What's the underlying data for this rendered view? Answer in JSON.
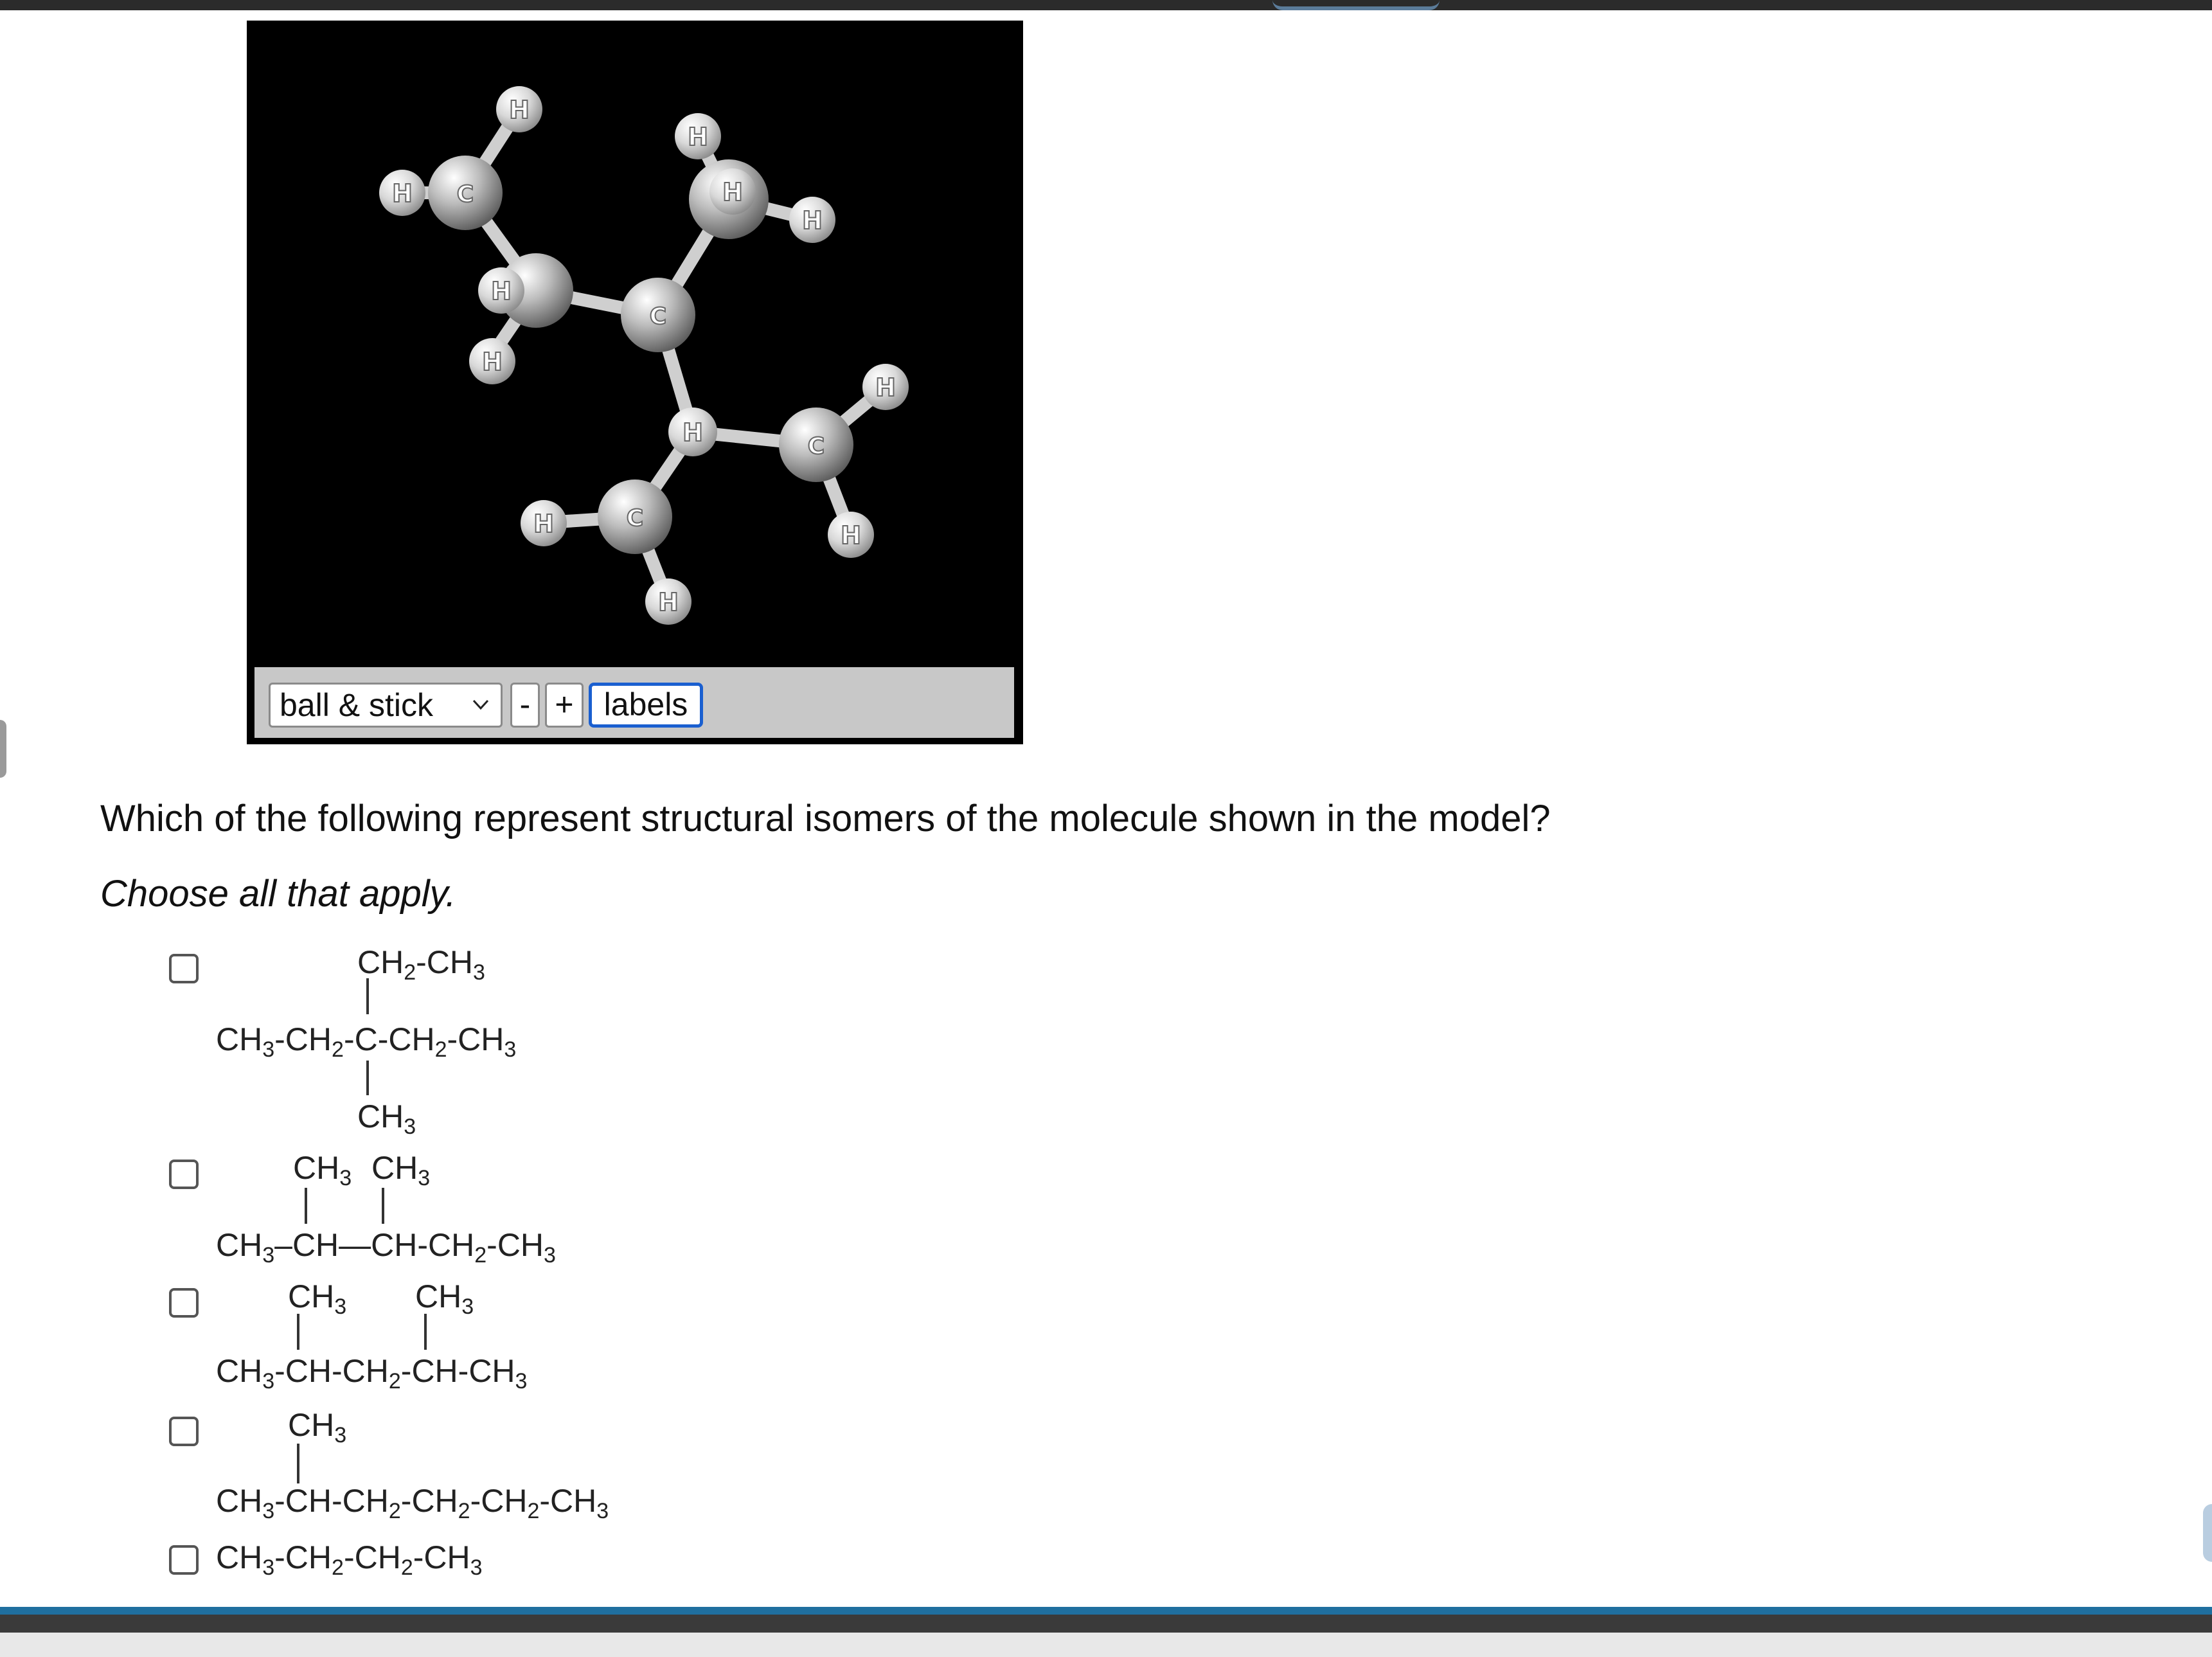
{
  "viewer": {
    "render_mode": "ball & stick",
    "minus_label": "-",
    "plus_label": "+",
    "labels_button": "labels",
    "atom_labels": {
      "hydrogen": "H",
      "carbon": "C"
    }
  },
  "question": {
    "text": "Which of the following represent structural isomers of the molecule shown in the model?",
    "instruction": "Choose all that apply."
  },
  "options": {
    "o1": {
      "top": [
        "CH",
        "2",
        "-CH",
        "3"
      ],
      "main": [
        "CH",
        "3",
        "-CH",
        "2",
        "-C-CH",
        "2",
        "-CH",
        "3"
      ],
      "bottom": [
        "CH",
        "3"
      ]
    },
    "o2": {
      "top_a": [
        "CH",
        "3"
      ],
      "top_b": [
        "CH",
        "3"
      ],
      "main": [
        "CH",
        "3",
        "–CH—CH-CH",
        "2",
        "-CH",
        "3"
      ]
    },
    "o3": {
      "top_a": [
        "CH",
        "3"
      ],
      "top_b": [
        "CH",
        "3"
      ],
      "main": [
        "CH",
        "3",
        "-CH-CH",
        "2",
        "-CH-CH",
        "3"
      ]
    },
    "o4": {
      "top": [
        "CH",
        "3"
      ],
      "main": [
        "CH",
        "3",
        "-CH-CH",
        "2",
        "-CH",
        "2",
        "-CH",
        "2",
        "-CH",
        "3"
      ]
    },
    "o5": {
      "main": [
        "CH",
        "3",
        "-CH",
        "2",
        "-CH",
        "2",
        "-CH",
        "3"
      ]
    }
  }
}
